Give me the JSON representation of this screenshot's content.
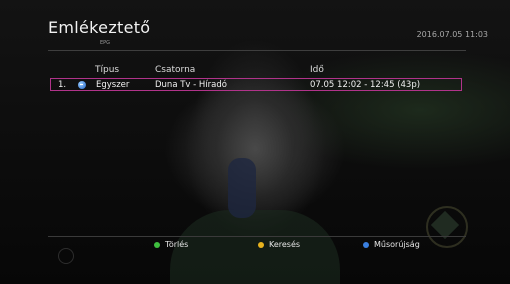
{
  "header": {
    "title": "Emlékeztető",
    "subtitle": "EPG",
    "datetime": "2016.07.05  11:03"
  },
  "table": {
    "columns": [
      "Típus",
      "Csatorna",
      "Idő"
    ],
    "rows": [
      {
        "index": "1.",
        "type": "Egyszer",
        "channel": "Duna Tv - Híradó",
        "time": "07.05  12:02 - 12:45 (43p)",
        "selected": true
      }
    ]
  },
  "footer": {
    "buttons": [
      {
        "label": "Törlés",
        "color": "#3fbf3f"
      },
      {
        "label": "Keresés",
        "color": "#e8b21e"
      },
      {
        "label": "Műsorújság",
        "color": "#3a7fe0"
      }
    ]
  },
  "colors": {
    "selection": "#b0338a",
    "text": "#f2f2f2"
  },
  "icons": {
    "row_type_icon": "reminder-icon"
  }
}
